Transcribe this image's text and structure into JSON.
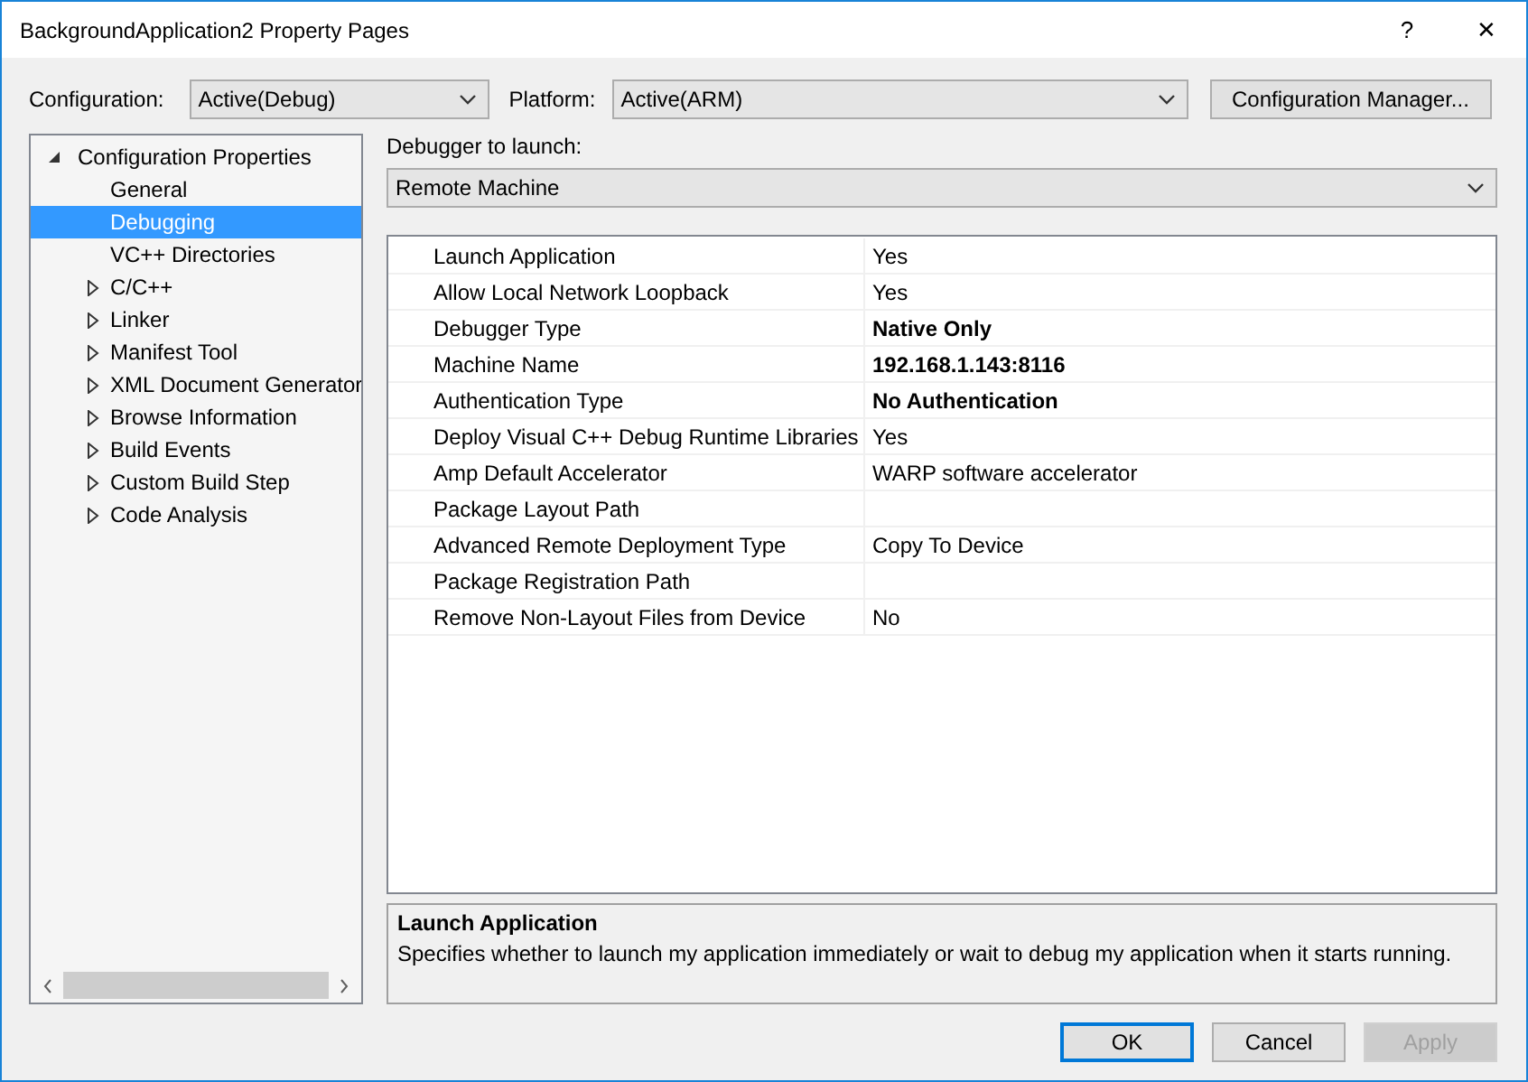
{
  "window": {
    "title": "BackgroundApplication2 Property Pages",
    "title_buttons": [
      "?",
      "✕"
    ]
  },
  "toolbar": {
    "configuration": {
      "label": "Configuration:",
      "value": "Active(Debug)"
    },
    "platform": {
      "label": "Platform:",
      "value": "Active(ARM)"
    },
    "manager_button": "Configuration Manager..."
  },
  "tree": {
    "root": {
      "label": "Configuration Properties",
      "expanded": true,
      "children": [
        {
          "label": "General",
          "kind": "page",
          "selected": false
        },
        {
          "label": "Debugging",
          "kind": "page",
          "selected": true
        },
        {
          "label": "VC++ Directories",
          "kind": "page",
          "selected": false
        },
        {
          "label": "C/C++",
          "kind": "group",
          "expanded": false,
          "selected": false
        },
        {
          "label": "Linker",
          "kind": "group",
          "expanded": false,
          "selected": false
        },
        {
          "label": "Manifest Tool",
          "kind": "group",
          "expanded": false,
          "selected": false
        },
        {
          "label": "XML Document Generator",
          "kind": "group",
          "expanded": false,
          "selected": false
        },
        {
          "label": "Browse Information",
          "kind": "group",
          "expanded": false,
          "selected": false
        },
        {
          "label": "Build Events",
          "kind": "group",
          "expanded": false,
          "selected": false
        },
        {
          "label": "Custom Build Step",
          "kind": "group",
          "expanded": false,
          "selected": false
        },
        {
          "label": "Code Analysis",
          "kind": "group",
          "expanded": false,
          "selected": false
        }
      ]
    }
  },
  "debugger": {
    "label": "Debugger to launch:",
    "value": "Remote Machine"
  },
  "properties": [
    {
      "name": "Launch Application",
      "value": "Yes",
      "bold": false
    },
    {
      "name": "Allow Local Network Loopback",
      "value": "Yes",
      "bold": false
    },
    {
      "name": "Debugger Type",
      "value": "Native Only",
      "bold": true
    },
    {
      "name": "Machine Name",
      "value": "192.168.1.143:8116",
      "bold": true
    },
    {
      "name": "Authentication Type",
      "value": "No Authentication",
      "bold": true
    },
    {
      "name": "Deploy Visual C++ Debug Runtime Libraries",
      "value": "Yes",
      "bold": false
    },
    {
      "name": "Amp Default Accelerator",
      "value": "WARP software accelerator",
      "bold": false
    },
    {
      "name": "Package Layout Path"
    },
    {
      "name": "Advanced Remote Deployment Type",
      "value": "Copy To Device",
      "bold": false
    },
    {
      "name": "Package Registration Path"
    },
    {
      "name": "Remove Non-Layout Files from Device",
      "value": "No",
      "bold": false
    }
  ],
  "description": {
    "title": "Launch Application",
    "text": "Specifies whether to launch my application immediately or wait to debug my application when it starts running."
  },
  "buttons": [
    {
      "label": "OK",
      "default": true,
      "disabled": false
    },
    {
      "label": "Cancel",
      "default": false,
      "disabled": false
    },
    {
      "label": "Apply",
      "default": false,
      "disabled": true
    }
  ]
}
